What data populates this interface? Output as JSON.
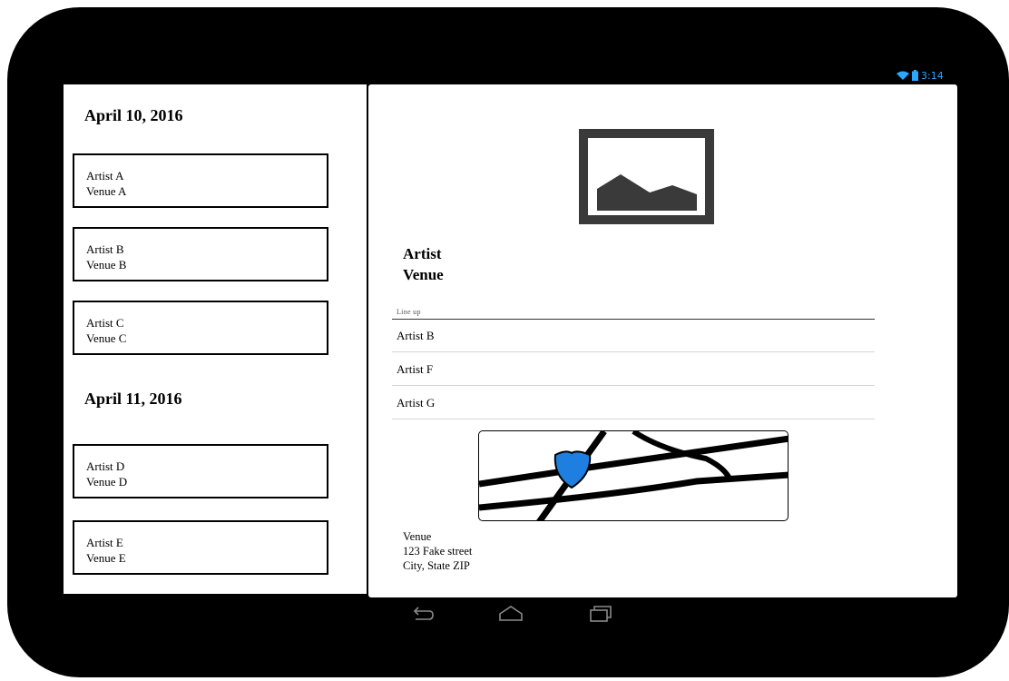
{
  "status_bar": {
    "time": "3:14",
    "wifi_icon": "wifi-icon",
    "battery_icon": "battery-icon"
  },
  "events": {
    "groups": [
      {
        "date": "April 10, 2016",
        "items": [
          {
            "artist": "Artist A",
            "venue": "Venue A"
          },
          {
            "artist": "Artist B",
            "venue": "Venue B"
          },
          {
            "artist": "Artist C",
            "venue": "Venue C"
          }
        ]
      },
      {
        "date": "April 11, 2016",
        "items": [
          {
            "artist": "Artist D",
            "venue": "Venue D"
          },
          {
            "artist": "Artist E",
            "venue": "Venue E"
          }
        ]
      }
    ]
  },
  "detail": {
    "image_icon": "image-placeholder-icon",
    "artist": "Artist",
    "venue": "Venue",
    "lineup_label": "Line up",
    "lineup": [
      "Artist B",
      "Artist F",
      "Artist G"
    ],
    "map_icon": "map-icon",
    "address": {
      "name": "Venue",
      "street": "123 Fake street",
      "city": "City, State ZIP"
    }
  },
  "navbar": {
    "back_icon": "back-icon",
    "home_icon": "home-icon",
    "recents_icon": "recent-apps-icon"
  }
}
